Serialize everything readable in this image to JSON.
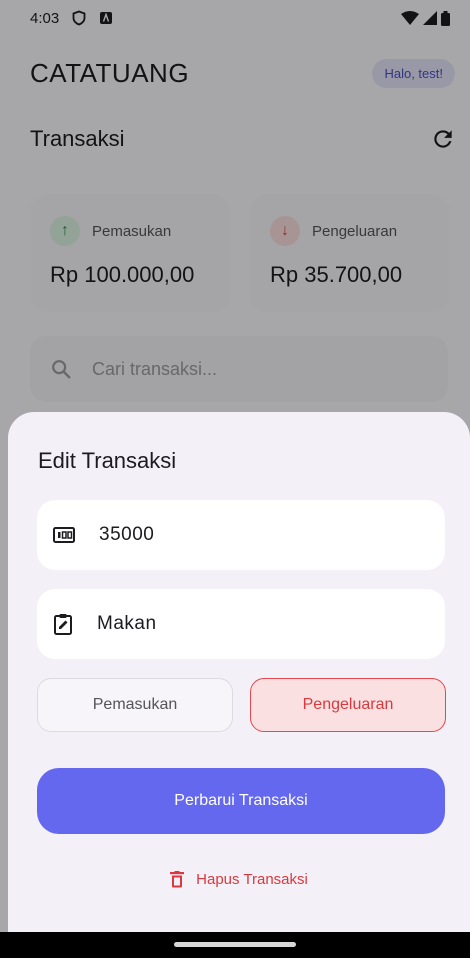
{
  "status_bar": {
    "time": "4:03",
    "icons": [
      "vpn-shield-icon",
      "notification-a-icon",
      "wifi-icon",
      "signal-icon",
      "battery-icon"
    ]
  },
  "header": {
    "app_name": "CATATUANG",
    "greeting": "Halo, test!"
  },
  "page": {
    "title": "Transaksi"
  },
  "summary": {
    "income": {
      "label": "Pemasukan",
      "amount": "Rp 100.000,00",
      "icon": "arrow-up-icon",
      "color": "#2e8b4a"
    },
    "expense": {
      "label": "Pengeluaran",
      "amount": "Rp 35.700,00",
      "icon": "arrow-down-icon",
      "color": "#d64545"
    }
  },
  "search": {
    "placeholder": "Cari transaksi..."
  },
  "sheet": {
    "title": "Edit Transaksi",
    "amount_value": "35000",
    "note_value": "Makan",
    "type_income_label": "Pemasukan",
    "type_expense_label": "Pengeluaran",
    "selected_type": "Pengeluaran",
    "submit_label": "Perbarui Transaksi",
    "delete_label": "Hapus Transaksi"
  },
  "colors": {
    "primary": "#6468ef",
    "danger": "#d93a3f",
    "sheet_bg": "#f4f0f8"
  }
}
